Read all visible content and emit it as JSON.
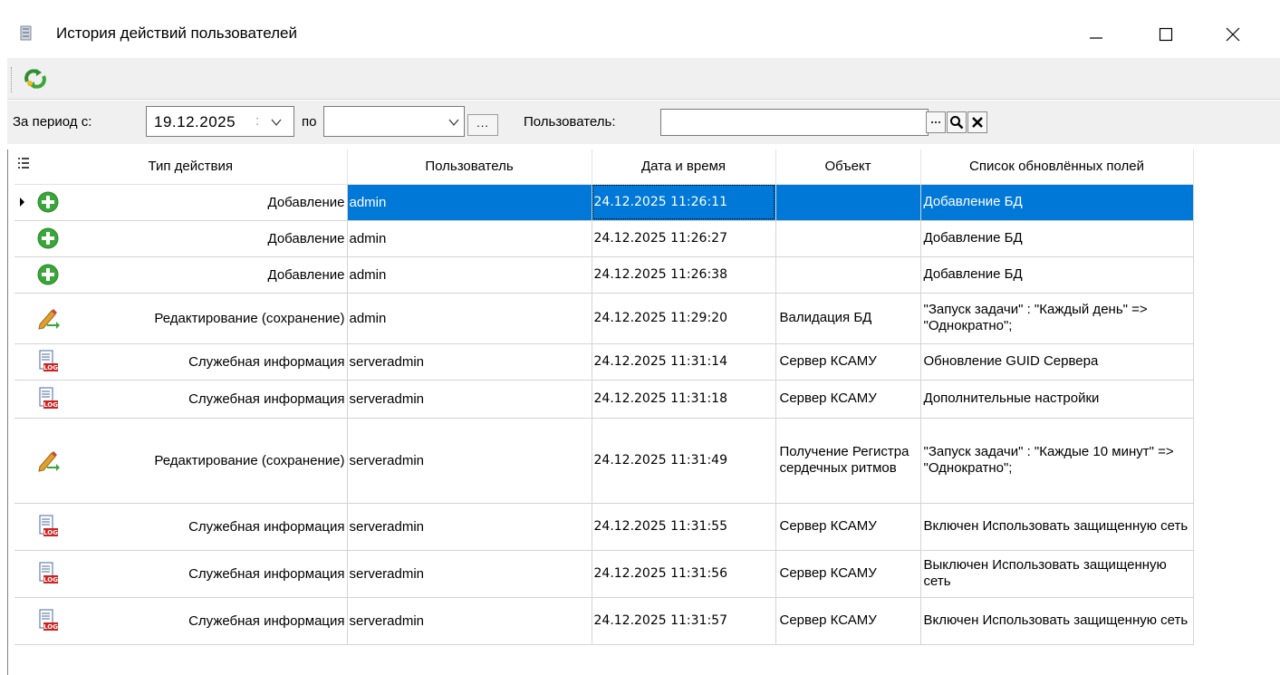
{
  "window": {
    "title": "История действий пользователей"
  },
  "filter": {
    "period_from_label": "За период с:",
    "date_from": "19.12.2025",
    "to_label": "по",
    "date_to": "",
    "dots_label": "...",
    "user_label": "Пользователь:",
    "user_value": ""
  },
  "grid": {
    "columns": [
      "Тип действия",
      "Пользователь",
      "Дата и время",
      "Объект",
      "Список обновлённых полей"
    ],
    "rows": [
      {
        "icon": "add-icon",
        "type": "Добавление",
        "user": "admin",
        "datetime": "24.12.2025 11:26:11",
        "object": "",
        "fields": "Добавление БД",
        "selected": true
      },
      {
        "icon": "add-icon",
        "type": "Добавление",
        "user": "admin",
        "datetime": "24.12.2025 11:26:27",
        "object": "",
        "fields": "Добавление БД"
      },
      {
        "icon": "add-icon",
        "type": "Добавление",
        "user": "admin",
        "datetime": "24.12.2025 11:26:38",
        "object": "",
        "fields": "Добавление БД"
      },
      {
        "icon": "edit-icon",
        "type": "Редактирование (сохранение)",
        "user": "admin",
        "datetime": "24.12.2025 11:29:20",
        "object": "Валидация БД",
        "fields": "\"Запуск задачи\" : \"Каждый день\" => \"Однократно\";"
      },
      {
        "icon": "log-icon",
        "type": "Служебная информация",
        "user": "serveradmin",
        "datetime": "24.12.2025 11:31:14",
        "object": "Сервер КСАМУ",
        "fields": "Обновление GUID Сервера"
      },
      {
        "icon": "log-icon",
        "type": "Служебная информация",
        "user": "serveradmin",
        "datetime": "24.12.2025 11:31:18",
        "object": "Сервер КСАМУ",
        "fields": "Дополнительные настройки"
      },
      {
        "icon": "edit-icon",
        "type": "Редактирование (сохранение)",
        "user": "serveradmin",
        "datetime": "24.12.2025 11:31:49",
        "object": "Получение Регистра сердечных ритмов",
        "fields": "\"Запуск задачи\" : \"Каждые 10 минут\" => \"Однократно\";"
      },
      {
        "icon": "log-icon",
        "type": "Служебная информация",
        "user": "serveradmin",
        "datetime": "24.12.2025 11:31:55",
        "object": "Сервер КСАМУ",
        "fields": "Включен Использовать защищенную сеть"
      },
      {
        "icon": "log-icon",
        "type": "Служебная информация",
        "user": "serveradmin",
        "datetime": "24.12.2025 11:31:56",
        "object": "Сервер КСАМУ",
        "fields": "Выключен Использовать защищенную сеть"
      },
      {
        "icon": "log-icon",
        "type": "Служебная информация",
        "user": "serveradmin",
        "datetime": "24.12.2025 11:31:57",
        "object": "Сервер КСАМУ",
        "fields": "Включен Использовать защищенную сеть"
      }
    ]
  },
  "colors": {
    "selection": "#0078d7",
    "add_icon": "#3aa63a",
    "log_icon": "#cc2222"
  }
}
